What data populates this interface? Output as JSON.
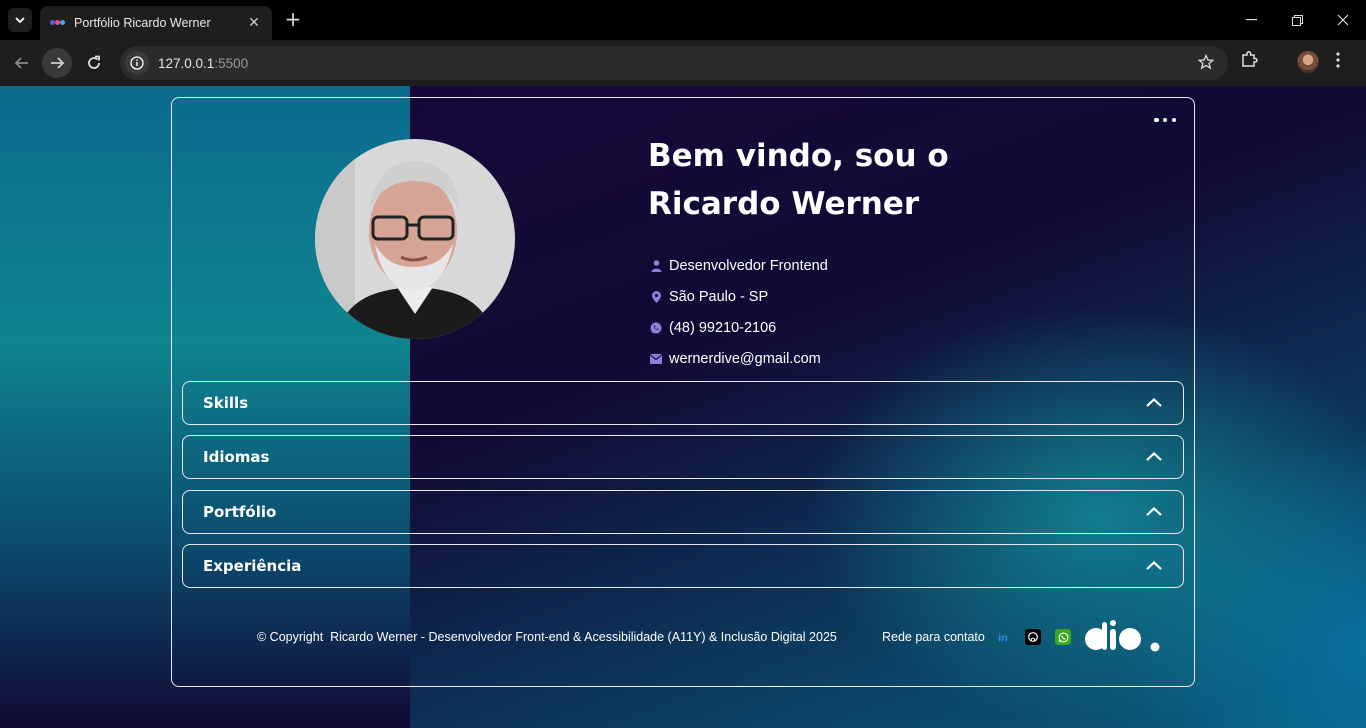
{
  "browser": {
    "tab_title": "Portfólio Ricardo Werner",
    "url_host": "127.0.0.1",
    "url_port": ":5500"
  },
  "profile": {
    "heading_line1": "Bem vindo, sou o",
    "heading_line2": "Ricardo Werner",
    "info": [
      {
        "icon": "user-icon",
        "text": "Desenvolvedor Frontend"
      },
      {
        "icon": "location-pin-icon",
        "text": "São Paulo - SP"
      },
      {
        "icon": "whatsapp-icon",
        "text": "(48) 99210-2106"
      },
      {
        "icon": "mail-icon",
        "text": "wernerdive@gmail.com"
      }
    ]
  },
  "accordion": [
    {
      "title": "Skills"
    },
    {
      "title": "Idiomas"
    },
    {
      "title": "Portfólio"
    },
    {
      "title": "Experiência"
    }
  ],
  "footer": {
    "copyright": "© Copyright  Ricardo Werner - Desenvolvedor Front-end & Acessibilidade (A11Y) & Inclusão Digital 2025",
    "contact_label": "Rede para contato",
    "social": [
      "linkedin-icon",
      "github-icon",
      "whatsapp-icon"
    ],
    "logo": "dio"
  },
  "colors": {
    "icon_purple": "#8b7fd8",
    "linkedin": "#0a66c2",
    "whatsapp": "#25d366",
    "border": "#e8e8f0"
  }
}
